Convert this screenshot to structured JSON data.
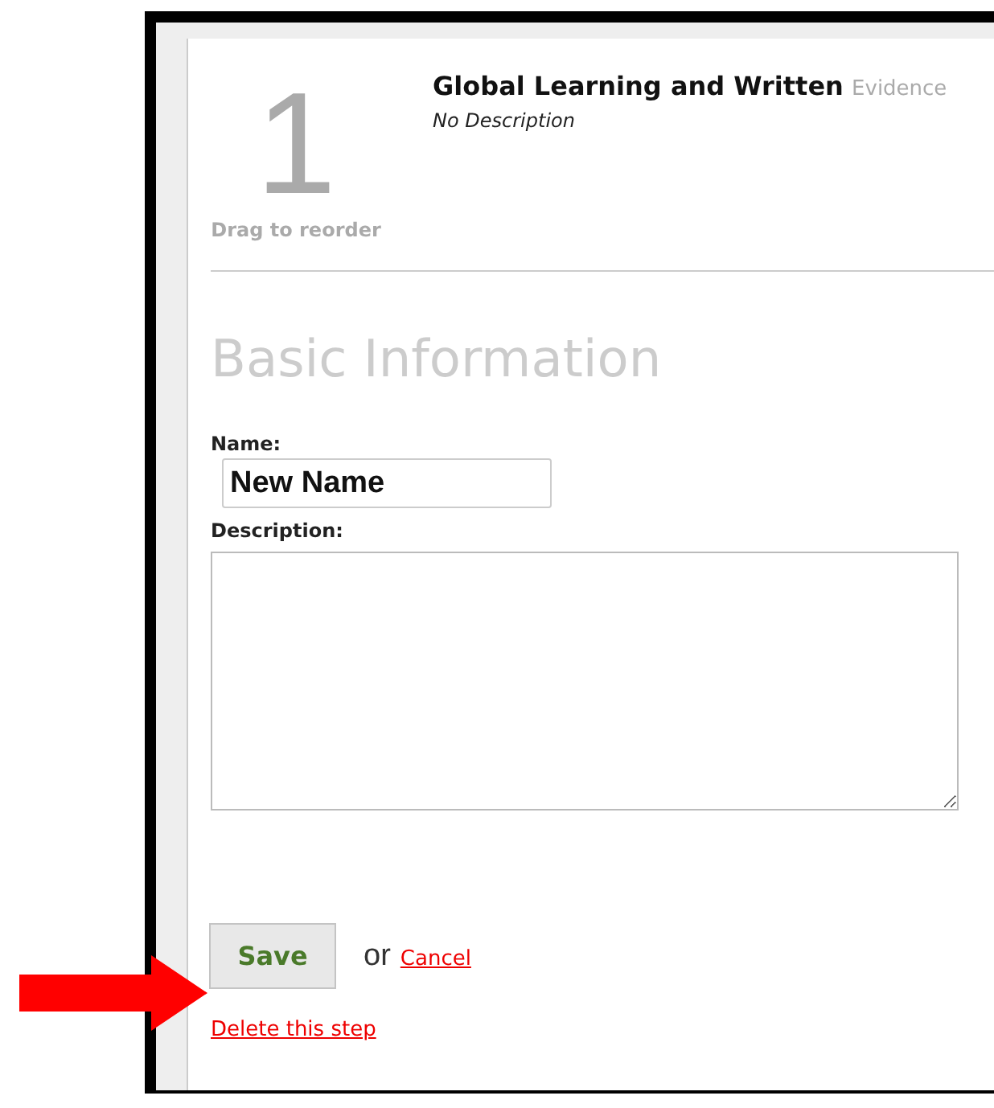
{
  "step": {
    "number": "1",
    "drag_hint": "Drag to reorder",
    "title": "Global Learning and Written",
    "type_label": "Evidence",
    "description": "No Description"
  },
  "form": {
    "section_title": "Basic Information",
    "name_field": {
      "label": "Name:",
      "value": "New Name"
    },
    "description_field": {
      "label": "Description:"
    },
    "save_label": "Save",
    "separator": "or",
    "cancel_label": "Cancel",
    "delete_label": "Delete this step"
  }
}
